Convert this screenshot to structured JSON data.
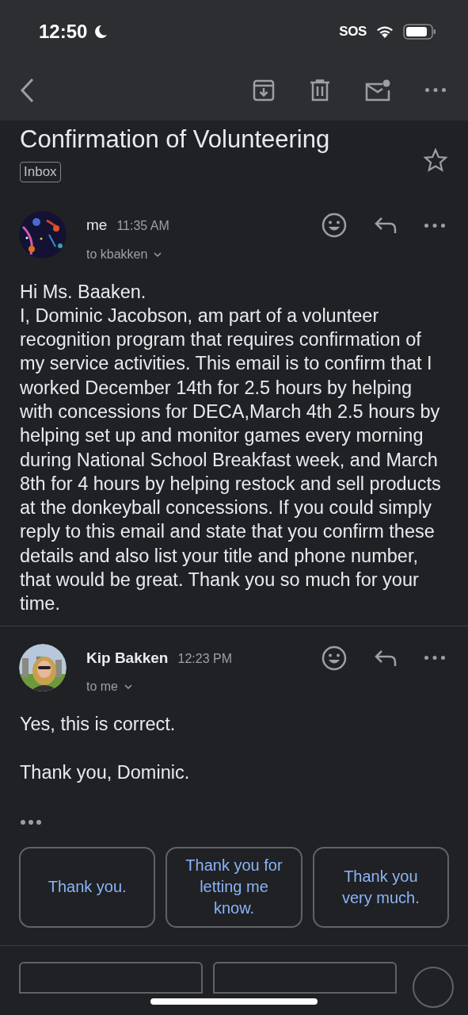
{
  "status_bar": {
    "time": "12:50",
    "sos": "SOS"
  },
  "subject": "Confirmation of Volunteering",
  "label": "Inbox",
  "starred": false,
  "messages": [
    {
      "sender": "me",
      "time": "11:35 AM",
      "recipient": "to kbakken",
      "bold_sender": false,
      "body": [
        "Hi Ms. Baaken.",
        "I, Dominic Jacobson, am part of a volunteer recognition program that requires confirmation of my service activities. This email is to confirm that I worked December 14th for 2.5 hours by helping with concessions for DECA,March 4th 2.5 hours by helping set up and monitor games every morning during National School Breakfast week, and March 8th for 4 hours by helping restock and sell products at the donkeyball concessions. If you could simply reply to this email and state that you confirm these details and also list your title and phone number, that would be great. Thank you so much for your time."
      ]
    },
    {
      "sender": "Kip Bakken",
      "time": "12:23 PM",
      "recipient": "to me",
      "bold_sender": true,
      "body": [
        "Yes, this is correct.",
        "Thank you, Dominic."
      ]
    }
  ],
  "smart_replies": [
    "Thank you.",
    "Thank you for letting me know.",
    "Thank you very much."
  ]
}
